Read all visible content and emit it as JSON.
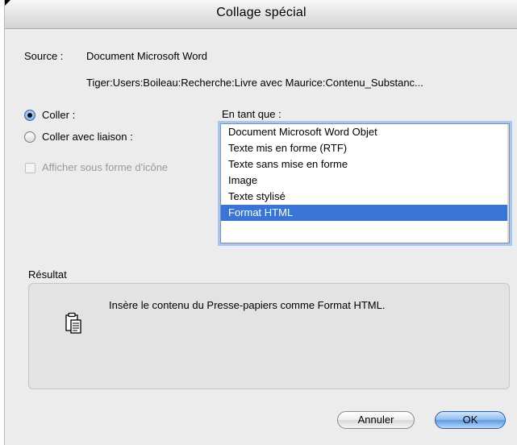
{
  "window": {
    "title": "Collage spécial"
  },
  "source": {
    "label": "Source :",
    "document": "Document Microsoft Word",
    "path": "Tiger:Users:Boileau:Recherche:Livre avec Maurice:Contenu_Substanc..."
  },
  "options": {
    "paste_label": "Coller :",
    "paste_selected": true,
    "paste_link_label": "Coller avec liaison :",
    "paste_link_selected": false,
    "show_icon_label": "Afficher sous forme d'icône",
    "show_icon_checked": false,
    "show_icon_enabled": false
  },
  "as_type": {
    "label": "En tant que :",
    "items": [
      "Document Microsoft Word Objet",
      "Texte mis en forme (RTF)",
      "Texte sans mise en forme",
      "Image",
      "Texte stylisé",
      "Format HTML"
    ],
    "selected_index": 5
  },
  "result": {
    "title": "Résultat",
    "icon": "clipboard-icon",
    "text": "Insère le contenu du Presse-papiers comme Format HTML."
  },
  "buttons": {
    "cancel": "Annuler",
    "ok": "OK"
  },
  "colors": {
    "selection": "#3875d7",
    "focus_ring": "#a9c6ec",
    "default_button": "#5d9ae3"
  }
}
